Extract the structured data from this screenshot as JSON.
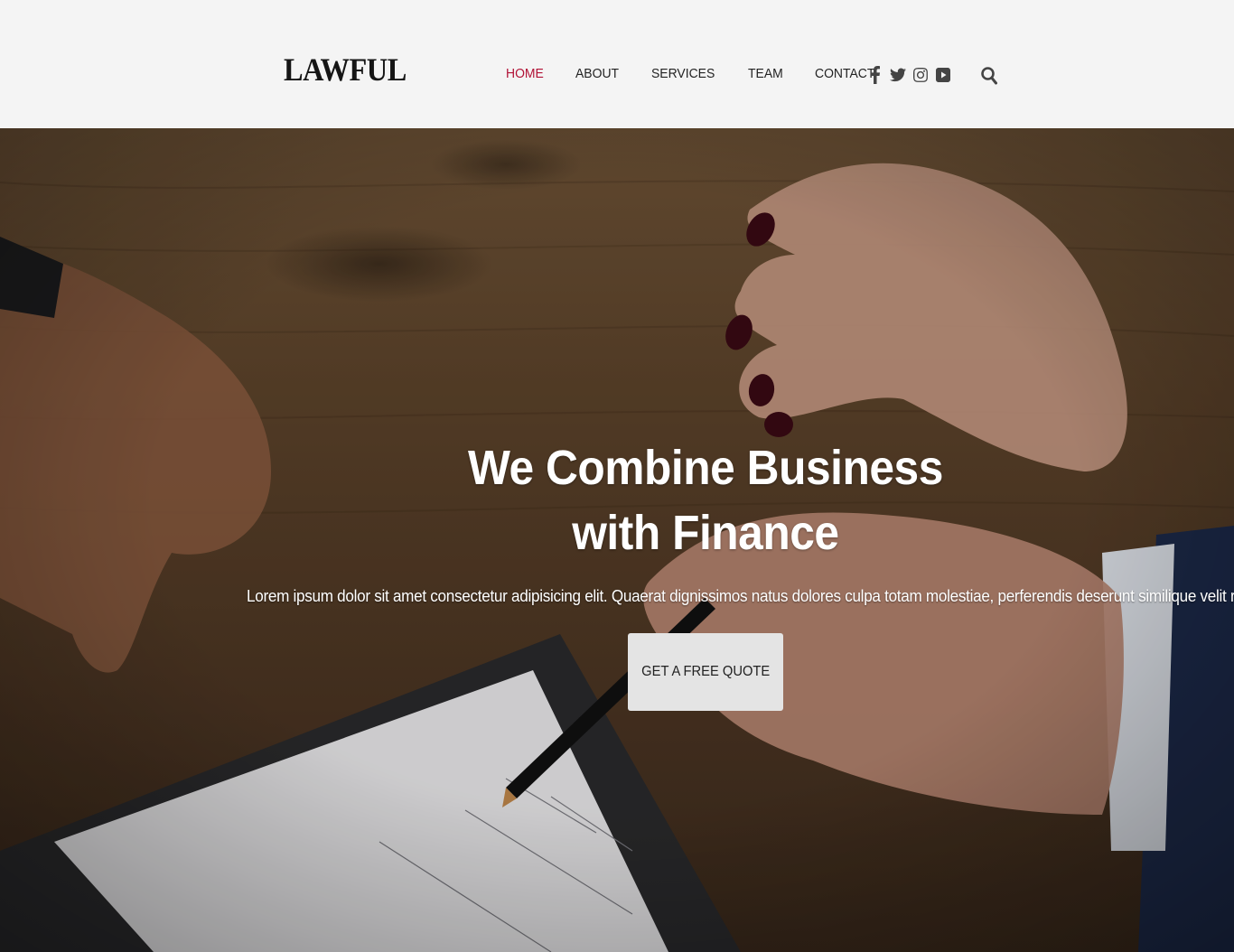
{
  "brand": {
    "logo": "LAWFUL"
  },
  "nav": {
    "items": [
      {
        "label": "HOME",
        "active": true
      },
      {
        "label": "ABOUT",
        "active": false
      },
      {
        "label": "SERVICES",
        "active": false
      },
      {
        "label": "TEAM",
        "active": false
      },
      {
        "label": "CONTACT",
        "active": false
      }
    ],
    "active_color": "#b11236"
  },
  "social": {
    "icons": [
      "facebook-icon",
      "twitter-icon",
      "instagram-icon",
      "youtube-icon"
    ]
  },
  "search": {
    "icon": "search-icon"
  },
  "hero": {
    "title_line1": "We Combine Business",
    "title_line2": "with Finance",
    "subtitle": "Lorem ipsum dolor sit amet consectetur adipisicing elit. Quaerat dignissimos natus dolores culpa totam molestiae, perferendis deserunt similique velit repellendus",
    "cta_label": "GET A FREE QUOTE"
  }
}
